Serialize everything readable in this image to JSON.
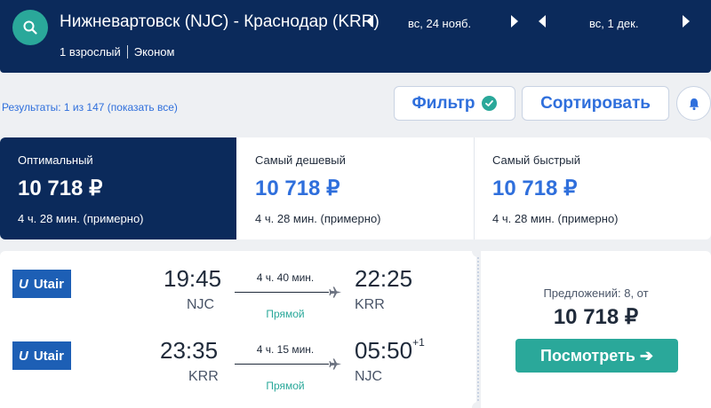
{
  "header": {
    "route": "Нижневартовск (NJC) - Краснодар (KRR)",
    "departure_date": "вс, 24 нояб.",
    "return_date": "вс, 1 дек.",
    "passengers": "1 взрослый",
    "cabin": "Эконом"
  },
  "toolbar": {
    "results_text": "Результаты: 1 из 147 (показать все)",
    "filter_label": "Фильтр",
    "sort_label": "Сортировать"
  },
  "sort_tabs": [
    {
      "label": "Оптимальный",
      "price": "10 718 ₽",
      "duration": "4 ч. 28 мин. (примерно)"
    },
    {
      "label": "Самый дешевый",
      "price": "10 718 ₽",
      "duration": "4 ч. 28 мин. (примерно)"
    },
    {
      "label": "Самый быстрый",
      "price": "10 718 ₽",
      "duration": "4 ч. 28 мин. (примерно)"
    }
  ],
  "ticket": {
    "legs": [
      {
        "airline": "Utair",
        "dep_time": "19:45",
        "dep_code": "NJC",
        "duration": "4 ч. 40 мин.",
        "stops": "Прямой",
        "arr_time": "22:25",
        "arr_plus": "",
        "arr_code": "KRR"
      },
      {
        "airline": "Utair",
        "dep_time": "23:35",
        "dep_code": "KRR",
        "duration": "4 ч. 15 мин.",
        "stops": "Прямой",
        "arr_time": "05:50",
        "arr_plus": "+1",
        "arr_code": "NJC"
      }
    ],
    "offers_text": "Предложений: 8, от",
    "price": "10 718 ₽",
    "view_label": "Посмотреть ➔"
  },
  "colors": {
    "header_bg": "#0b2a5b",
    "accent_teal": "#2aa89a",
    "link_blue": "#2f6fdc",
    "airline_blue": "#1d5fb5"
  }
}
